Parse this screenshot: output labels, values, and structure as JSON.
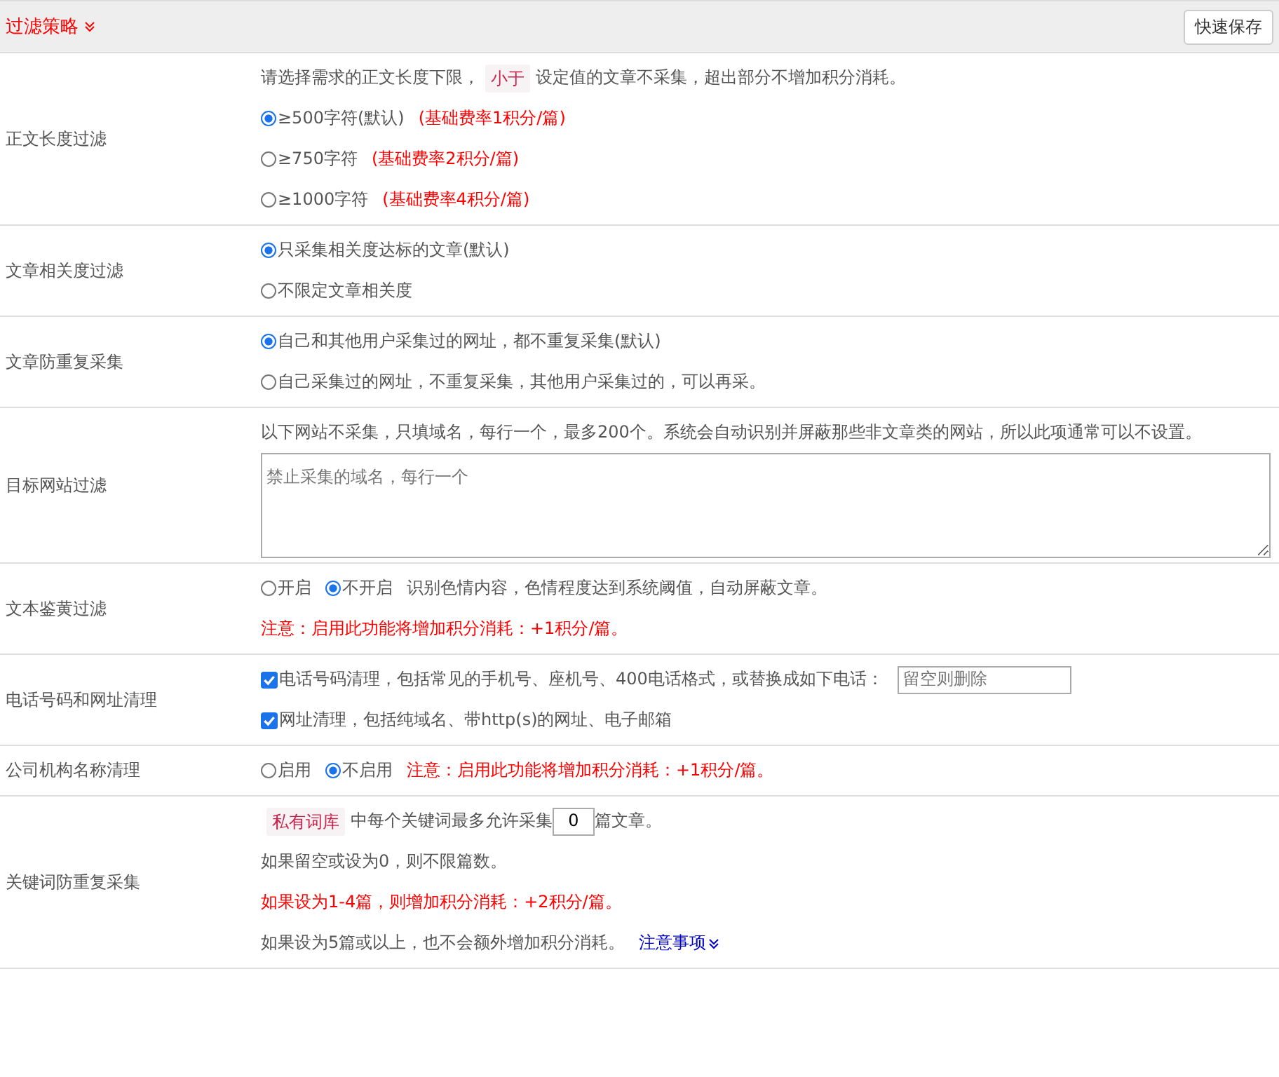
{
  "header": {
    "title": "过滤策略",
    "button": "快速保存"
  },
  "rows": [
    {
      "label": "正文长度过滤",
      "lines": [
        [
          {
            "kind": "text",
            "text": "请选择需求的正文长度下限，"
          },
          {
            "kind": "tag",
            "text": "小于"
          },
          {
            "kind": "text",
            "text": "设定值的文章不采集，超出部分不增加积分消耗。"
          }
        ],
        [
          {
            "kind": "radio",
            "label": "≥500字符(默认)",
            "selected": true
          },
          {
            "kind": "red",
            "text": "(基础费率1积分/篇)"
          }
        ],
        [
          {
            "kind": "radio",
            "label": "≥750字符",
            "selected": false
          },
          {
            "kind": "red",
            "text": "(基础费率2积分/篇)"
          }
        ],
        [
          {
            "kind": "radio",
            "label": "≥1000字符",
            "selected": false
          },
          {
            "kind": "red",
            "text": "(基础费率4积分/篇)"
          }
        ]
      ]
    },
    {
      "label": "文章相关度过滤",
      "lines": [
        [
          {
            "kind": "radio",
            "label": "只采集相关度达标的文章(默认)",
            "selected": true
          }
        ],
        [
          {
            "kind": "radio",
            "label": "不限定文章相关度",
            "selected": false
          }
        ]
      ]
    },
    {
      "label": "文章防重复采集",
      "lines": [
        [
          {
            "kind": "radio",
            "label": "自己和其他用户采集过的网址，都不重复采集(默认)",
            "selected": true
          }
        ],
        [
          {
            "kind": "radio",
            "label": "自己采集过的网址，不重复采集，其他用户采集过的，可以再采。",
            "selected": false
          }
        ]
      ]
    },
    {
      "label": "目标网站过滤",
      "lines": [
        [
          {
            "kind": "text",
            "text": "以下网站不采集，只填域名，每行一个，最多200个。系统会自动识别并屏蔽那些非文章类的网站，所以此项通常可以不设置。"
          }
        ],
        [
          {
            "kind": "textarea",
            "placeholder": "禁止采集的域名，每行一个"
          }
        ]
      ]
    },
    {
      "label": "文本鉴黄过滤",
      "lines": [
        [
          {
            "kind": "radio",
            "label": "开启",
            "selected": false
          },
          {
            "kind": "radio",
            "label": "不开启",
            "selected": true
          },
          {
            "kind": "text",
            "text": "识别色情内容，色情程度达到系统阈值，自动屏蔽文章。"
          }
        ],
        [
          {
            "kind": "red",
            "text": "注意：启用此功能将增加积分消耗：+1积分/篇。"
          }
        ]
      ]
    },
    {
      "label": "电话号码和网址清理",
      "lines": [
        [
          {
            "kind": "checkbox",
            "label": "电话号码清理，包括常见的手机号、座机号、400电话格式，或替换成如下电话：",
            "checked": true
          },
          {
            "kind": "input",
            "placeholder": "留空则删除"
          }
        ],
        [
          {
            "kind": "checkbox",
            "label": "网址清理，包括纯域名、带http(s)的网址、电子邮箱",
            "checked": true
          }
        ]
      ]
    },
    {
      "label": "公司机构名称清理",
      "lines": [
        [
          {
            "kind": "radio",
            "label": "启用",
            "selected": false
          },
          {
            "kind": "radio",
            "label": "不启用",
            "selected": true
          },
          {
            "kind": "red",
            "text": "注意：启用此功能将增加积分消耗：+1积分/篇。"
          }
        ]
      ]
    },
    {
      "label": "关键词防重复采集",
      "lines": [
        [
          {
            "kind": "tag",
            "text": "私有词库"
          },
          {
            "kind": "text",
            "text": "中每个关键词最多允许采集"
          },
          {
            "kind": "number",
            "value": "0"
          },
          {
            "kind": "text",
            "text": "篇文章。"
          }
        ],
        [
          {
            "kind": "text",
            "text": "如果留空或设为0，则不限篇数。"
          }
        ],
        [
          {
            "kind": "red",
            "text": "如果设为1-4篇，则增加积分消耗：+2积分/篇。"
          }
        ],
        [
          {
            "kind": "text",
            "text": "如果设为5篇或以上，也不会额外增加积分消耗。"
          },
          {
            "kind": "link",
            "text": "注意事项"
          }
        ]
      ]
    }
  ]
}
